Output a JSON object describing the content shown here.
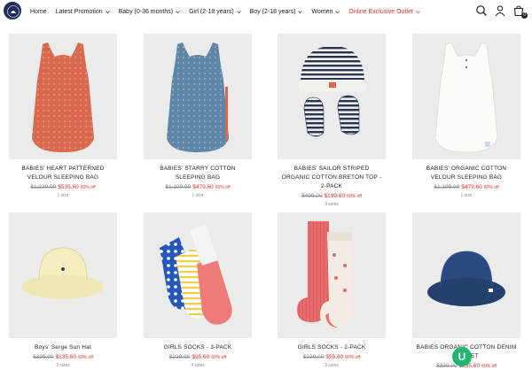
{
  "nav": {
    "items": [
      {
        "label": "Home",
        "chevron": false,
        "special": false
      },
      {
        "label": "Latest Promotion",
        "chevron": true,
        "special": false
      },
      {
        "label": "Baby (0-36 months)",
        "chevron": true,
        "special": false
      },
      {
        "label": "Girl (2-18 years)",
        "chevron": true,
        "special": false
      },
      {
        "label": "Boy (2-18 years)",
        "chevron": true,
        "special": false
      },
      {
        "label": "Women",
        "chevron": true,
        "special": false
      },
      {
        "label": "Online Exclusive Outlet",
        "chevron": true,
        "special": true
      }
    ],
    "cart_count": "0"
  },
  "colors": {
    "sale_red": "#d8322b",
    "image_bg": "#ebebeb",
    "brand_navy": "#1f2d5a"
  },
  "products": [
    {
      "name": "BABIES' HEART PATTERNED VELOUR SLEEPING BAG",
      "old_price": "$1,339.00",
      "new_price": "$535.60",
      "discount": "60% off",
      "sizes": "1 size",
      "image": "orange-sleeping-bag"
    },
    {
      "name": "BABIES' STARRY COTTON SLEEPING BAG",
      "old_price": "$1,199.00",
      "new_price": "$479.60",
      "discount": "60% off",
      "sizes": "1 size",
      "image": "blue-sleeping-bag"
    },
    {
      "name": "BABIES' SAILOR STRIPED ORGANIC COTTON BRETON TOP - 2-PACK",
      "old_price": "$499.00",
      "new_price": "$199.60",
      "discount": "60% off",
      "sizes": "3 sizes",
      "image": "striped-hat-and-booties"
    },
    {
      "name": "BABIES' ORGANIC COTTON VELOUR SLEEPING BAG",
      "old_price": "$1,199.00",
      "new_price": "$479.60",
      "discount": "60% off",
      "sizes": "1 size",
      "image": "white-sleeping-bag"
    },
    {
      "name": "Boys' Serge Sun Hat",
      "old_price": "$339.00",
      "new_price": "$135.60",
      "discount": "60% off",
      "sizes": "3 sizes",
      "image": "yellow-sun-hat"
    },
    {
      "name": "GIRLS SOCKS - 3-PACK",
      "old_price": "$239.00",
      "new_price": "$95.60",
      "discount": "60% off",
      "sizes": "4 sizes",
      "image": "socks-3-pack"
    },
    {
      "name": "GIRLS SOCKS - 2-PACK",
      "old_price": "$239.00",
      "new_price": "$95.60",
      "discount": "60% off",
      "sizes": "3 sizes",
      "image": "socks-2-pack"
    },
    {
      "name": "BABIES ORGANIC COTTON DENIM BUCKET",
      "old_price": "$339.00",
      "new_price": "$135.60",
      "discount": "60% off",
      "sizes": "",
      "image": "denim-bucket-hat"
    }
  ],
  "chat": {
    "label": "U"
  }
}
